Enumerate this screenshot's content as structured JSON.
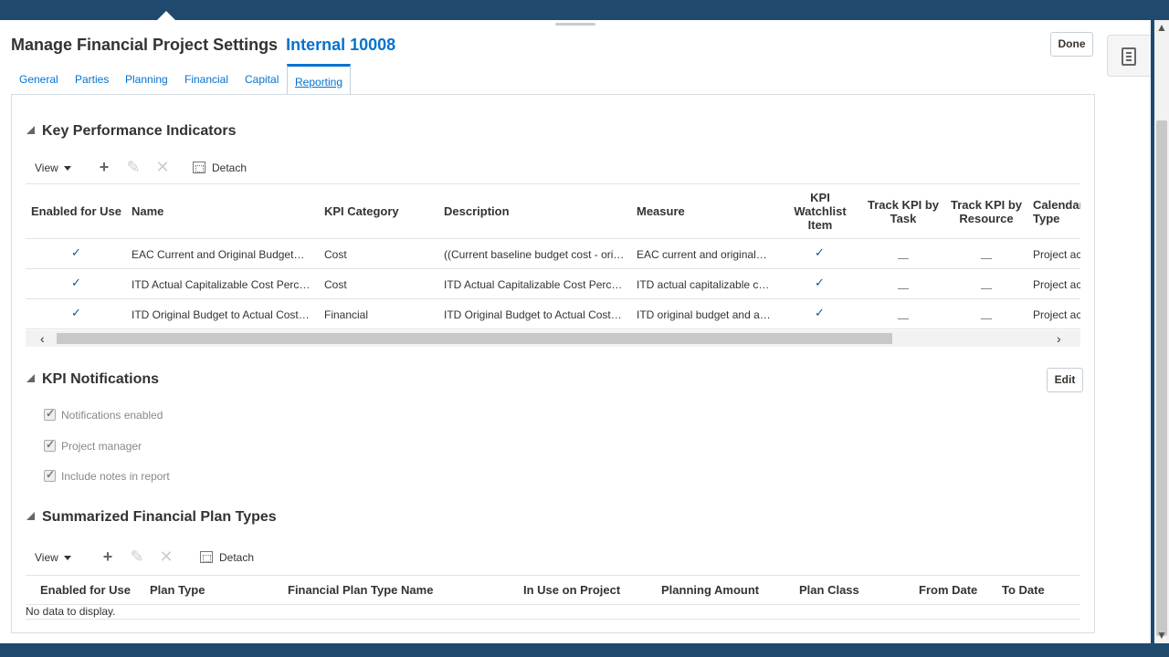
{
  "page": {
    "title": "Manage Financial Project Settings",
    "subtitle": "Internal 10008",
    "done_label": "Done"
  },
  "tabs": [
    {
      "label": "General"
    },
    {
      "label": "Parties"
    },
    {
      "label": "Planning"
    },
    {
      "label": "Financial"
    },
    {
      "label": "Capital"
    },
    {
      "label": "Reporting",
      "active": true
    }
  ],
  "kpi": {
    "heading": "Key Performance Indicators",
    "toolbar": {
      "view_label": "View",
      "detach_label": "Detach"
    },
    "columns": [
      "Enabled for Use",
      "Name",
      "KPI Category",
      "Description",
      "Measure",
      "KPI Watchlist Item",
      "Track KPI by Task",
      "Track KPI by Resource",
      "Calendar Type"
    ],
    "rows": [
      {
        "enabled": "✓",
        "name": "EAC Current and Original Budget…",
        "category": "Cost",
        "description": "((Current baseline budget cost - ori…",
        "measure": "EAC current and original…",
        "watchlist": "✓",
        "calendar": "Project ac"
      },
      {
        "enabled": "✓",
        "name": "ITD Actual Capitalizable Cost Perc…",
        "category": "Cost",
        "description": "ITD Actual Capitalizable Cost Perc…",
        "measure": "ITD actual capitalizable c…",
        "watchlist": "✓",
        "calendar": "Project ac"
      },
      {
        "enabled": "✓",
        "name": "ITD Original Budget to Actual Cost…",
        "category": "Financial",
        "description": "ITD Original Budget to Actual Cost…",
        "measure": "ITD original budget and a…",
        "watchlist": "✓",
        "calendar": "Project ac"
      }
    ]
  },
  "notifications": {
    "heading": "KPI Notifications",
    "edit_label": "Edit",
    "options": [
      {
        "label": "Notifications enabled",
        "checked": true
      },
      {
        "label": "Project manager",
        "checked": true
      },
      {
        "label": "Include notes in report",
        "checked": true
      }
    ]
  },
  "plan_types": {
    "heading": "Summarized Financial Plan Types",
    "toolbar": {
      "view_label": "View",
      "detach_label": "Detach"
    },
    "columns": [
      "Enabled for Use",
      "Plan Type",
      "Financial Plan Type Name",
      "In Use on Project",
      "Planning Amount",
      "Plan Class",
      "From Date",
      "To Date"
    ],
    "empty_text": "No data to display."
  },
  "colors": {
    "accent": "#0572ce",
    "chrome": "#1f4a6e",
    "border": "#d6dfe6"
  }
}
